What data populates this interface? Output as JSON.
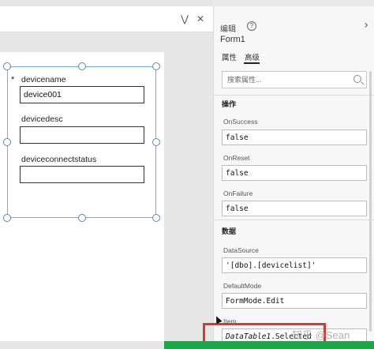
{
  "left": {
    "toolbar": {
      "collapse_icon": "double-chevron-down-icon",
      "close_icon": "close-icon"
    },
    "form": {
      "required_marker": "*",
      "fields": [
        {
          "label": "devicename",
          "value": "device001"
        },
        {
          "label": "devicedesc",
          "value": ""
        },
        {
          "label": "deviceconnectstatus",
          "value": ""
        }
      ]
    }
  },
  "panel": {
    "title": "编辑",
    "help_icon": "?",
    "form_name": "Form1",
    "tabs": [
      {
        "label": "属性"
      },
      {
        "label": "高级",
        "active": true
      }
    ],
    "search": {
      "placeholder": "搜索属性..."
    },
    "sections": {
      "actions": {
        "title": "操作",
        "props": [
          {
            "label": "OnSuccess",
            "value": "false"
          },
          {
            "label": "OnReset",
            "value": "false"
          },
          {
            "label": "OnFailure",
            "value": "false"
          }
        ]
      },
      "data": {
        "title": "数据",
        "props": [
          {
            "label": "DataSource",
            "value": "'[dbo].[devicelist]'"
          },
          {
            "label": "DefaultMode",
            "value": "FormMode.Edit"
          },
          {
            "label": "Item",
            "value_italic": "DataTable1",
            "value_rest": ".Selected"
          }
        ]
      }
    }
  },
  "watermark": "知乎 @Sean",
  "colors": {
    "highlight": "#d53a35",
    "status_bar": "#1ea54a",
    "selection": "#7ea7c9"
  }
}
